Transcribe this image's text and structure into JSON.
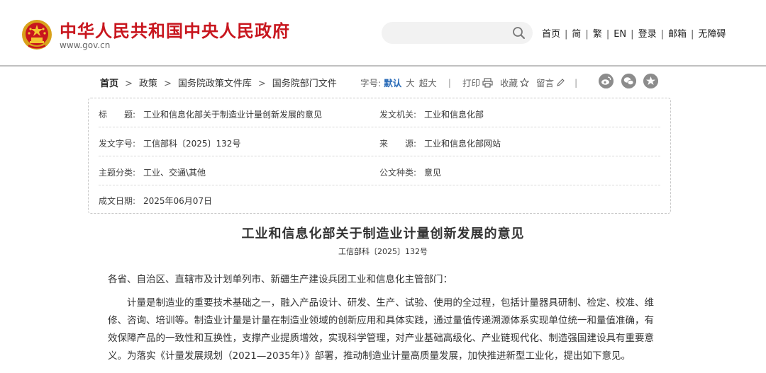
{
  "header": {
    "site_title": "中华人民共和国中央人民政府",
    "site_url": "www.gov.cn",
    "search_placeholder": "",
    "nav": [
      "首页",
      "简",
      "繁",
      "EN",
      "登录",
      "邮箱",
      "无障碍"
    ]
  },
  "breadcrumb": {
    "items": [
      "首页",
      "政策",
      "国务院政策文件库",
      "国务院部门文件"
    ]
  },
  "tools": {
    "font_label": "字号:",
    "font_default": "默认",
    "font_large": "大",
    "font_xlarge": "超大",
    "print": "打印",
    "favorite": "收藏",
    "comment": "留言"
  },
  "meta": {
    "title_label": "标　　题:",
    "title_value": "工业和信息化部关于制造业计量创新发展的意见",
    "issuer_label": "发文机关:",
    "issuer_value": "工业和信息化部",
    "doc_no_label": "发文字号:",
    "doc_no_value": "工信部科〔2025〕132号",
    "source_label": "来　　源:",
    "source_value": "工业和信息化部网站",
    "topic_label": "主题分类:",
    "topic_value": "工业、交通\\其他",
    "type_label": "公文种类:",
    "type_value": "意见",
    "date_label": "成文日期:",
    "date_value": "2025年06月07日"
  },
  "article": {
    "title": "工业和信息化部关于制造业计量创新发展的意见",
    "number": "工信部科〔2025〕132号",
    "salutation": "各省、自治区、直辖市及计划单列市、新疆生产建设兵团工业和信息化主管部门：",
    "paragraph1": "计量是制造业的重要技术基础之一，融入产品设计、研发、生产、试验、使用的全过程，包括计量器具研制、检定、校准、维修、咨询、培训等。制造业计量是计量在制造业领域的创新应用和具体实践，通过量值传递溯源体系实现单位统一和量值准确，有效保障产品的一致性和互换性，支撑产业提质增效，实现科学管理，对产业基础高级化、产业链现代化、制造强国建设具有重要意义。为落实《计量发展规划（2021—2035年）》部署，推动制造业计量高质量发展，加快推进新型工业化，提出如下意见。"
  },
  "colors": {
    "brand_red": "#c8161e",
    "accent_blue": "#2b6cb8"
  },
  "icons": [
    "national-emblem-icon",
    "search-icon",
    "print-icon",
    "star-icon",
    "pencil-icon",
    "weibo-icon",
    "wechat-icon",
    "favorite-star-icon"
  ]
}
